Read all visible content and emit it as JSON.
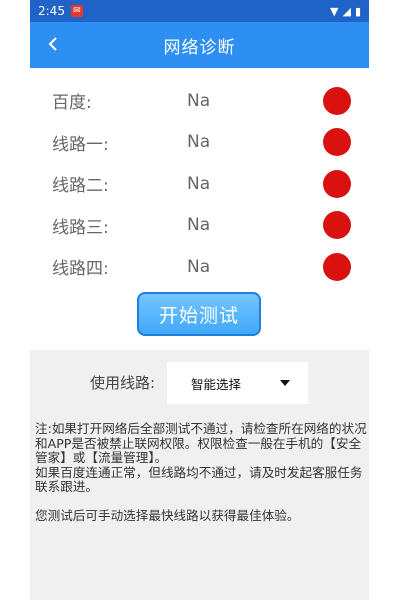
{
  "statusbar": {
    "time": "2:45",
    "notification_icon": "app-notification-icon",
    "right_icons": [
      "wifi-icon",
      "signal-icon",
      "battery-icon"
    ]
  },
  "appbar": {
    "title": "网络诊断",
    "back_icon": "back-arrow-icon"
  },
  "rows": [
    {
      "label": "百度:",
      "value": "Na",
      "status_color": "#d9120f"
    },
    {
      "label": "线路一:",
      "value": "Na",
      "status_color": "#d9120f"
    },
    {
      "label": "线路二:",
      "value": "Na",
      "status_color": "#d9120f"
    },
    {
      "label": "线路三:",
      "value": "Na",
      "status_color": "#d9120f"
    },
    {
      "label": "线路四:",
      "value": "Na",
      "status_color": "#d9120f"
    }
  ],
  "test_button": {
    "label": "开始测试"
  },
  "route_select": {
    "label": "使用线路:",
    "selected": "智能选择"
  },
  "notes": {
    "line1": "注:如果打开网络后全部测试不通过，请检查所在网络的状况和APP是否被禁止联网权限。权限检查一般在手机的【安全管家】或【流量管理】。",
    "line2": "如果百度连通正常，但线路均不通过，请及时发起客服任务联系跟进。",
    "line3": "您测试后可手动选择最快线路以获得最佳体验。"
  },
  "colors": {
    "statusbar": "#1f63c6",
    "appbar": "#2d8ff2",
    "status_dot": "#d9120f",
    "panel": "#f0f0f0"
  }
}
